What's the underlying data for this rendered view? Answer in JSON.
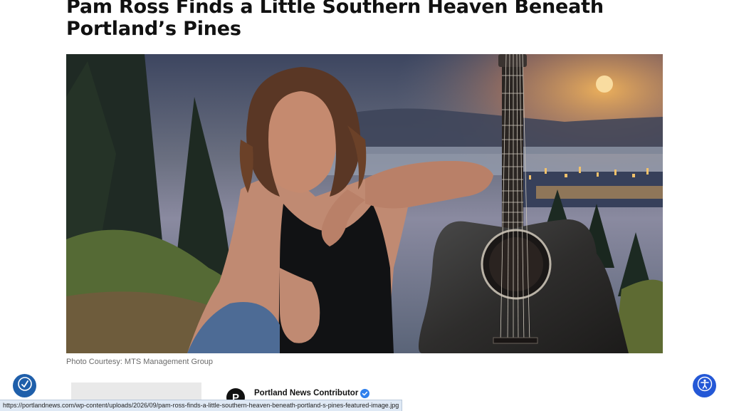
{
  "article": {
    "headline": "Pam Ross Finds a Little Southern Heaven Beneath Portland’s Pines",
    "photo_caption": "Photo Courtesy: MTS Management Group",
    "author": {
      "name": "Portland News Contributor",
      "logo_letter": "P",
      "verified": true
    }
  },
  "widgets": {
    "left_icon": "accessibility-hand-icon",
    "right_icon": "accessibility-person-icon"
  },
  "status_bar": {
    "url": "https://portlandnews.com/wp-content/uploads/2026/09/pam-ross-finds-a-little-southern-heaven-beneath-portland-s-pines-featured-image.jpg"
  },
  "colors": {
    "left_widget": "#1f5faa",
    "right_widget": "#2458d6",
    "verified_badge": "#2f80ed"
  }
}
